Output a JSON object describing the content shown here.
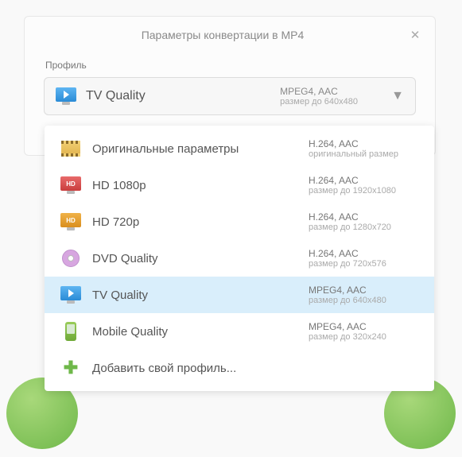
{
  "dialog": {
    "title": "Параметры конвертации в MP4",
    "close": "✕",
    "profileLabel": "Профиль"
  },
  "selected": {
    "label": "TV Quality",
    "codec": "MPEG4, AAC",
    "size": "размер до 640x480"
  },
  "items": [
    {
      "label": "Оригинальные параметры",
      "codec": "H.264, AAC",
      "size": "оригинальный размер",
      "icon": "film",
      "selected": false
    },
    {
      "label": "HD 1080p",
      "codec": "H.264, AAC",
      "size": "размер до 1920x1080",
      "icon": "hd-red",
      "selected": false
    },
    {
      "label": "HD 720p",
      "codec": "H.264, AAC",
      "size": "размер до 1280x720",
      "icon": "hd-orange",
      "selected": false
    },
    {
      "label": "DVD Quality",
      "codec": "H.264, AAC",
      "size": "размер до 720x576",
      "icon": "dvd",
      "selected": false
    },
    {
      "label": "TV Quality",
      "codec": "MPEG4, AAC",
      "size": "размер до 640x480",
      "icon": "tv",
      "selected": true
    },
    {
      "label": "Mobile Quality",
      "codec": "MPEG4, AAC",
      "size": "размер до 320x240",
      "icon": "mobile",
      "selected": false
    },
    {
      "label": "Добавить свой профиль...",
      "codec": "",
      "size": "",
      "icon": "plus",
      "selected": false
    }
  ]
}
